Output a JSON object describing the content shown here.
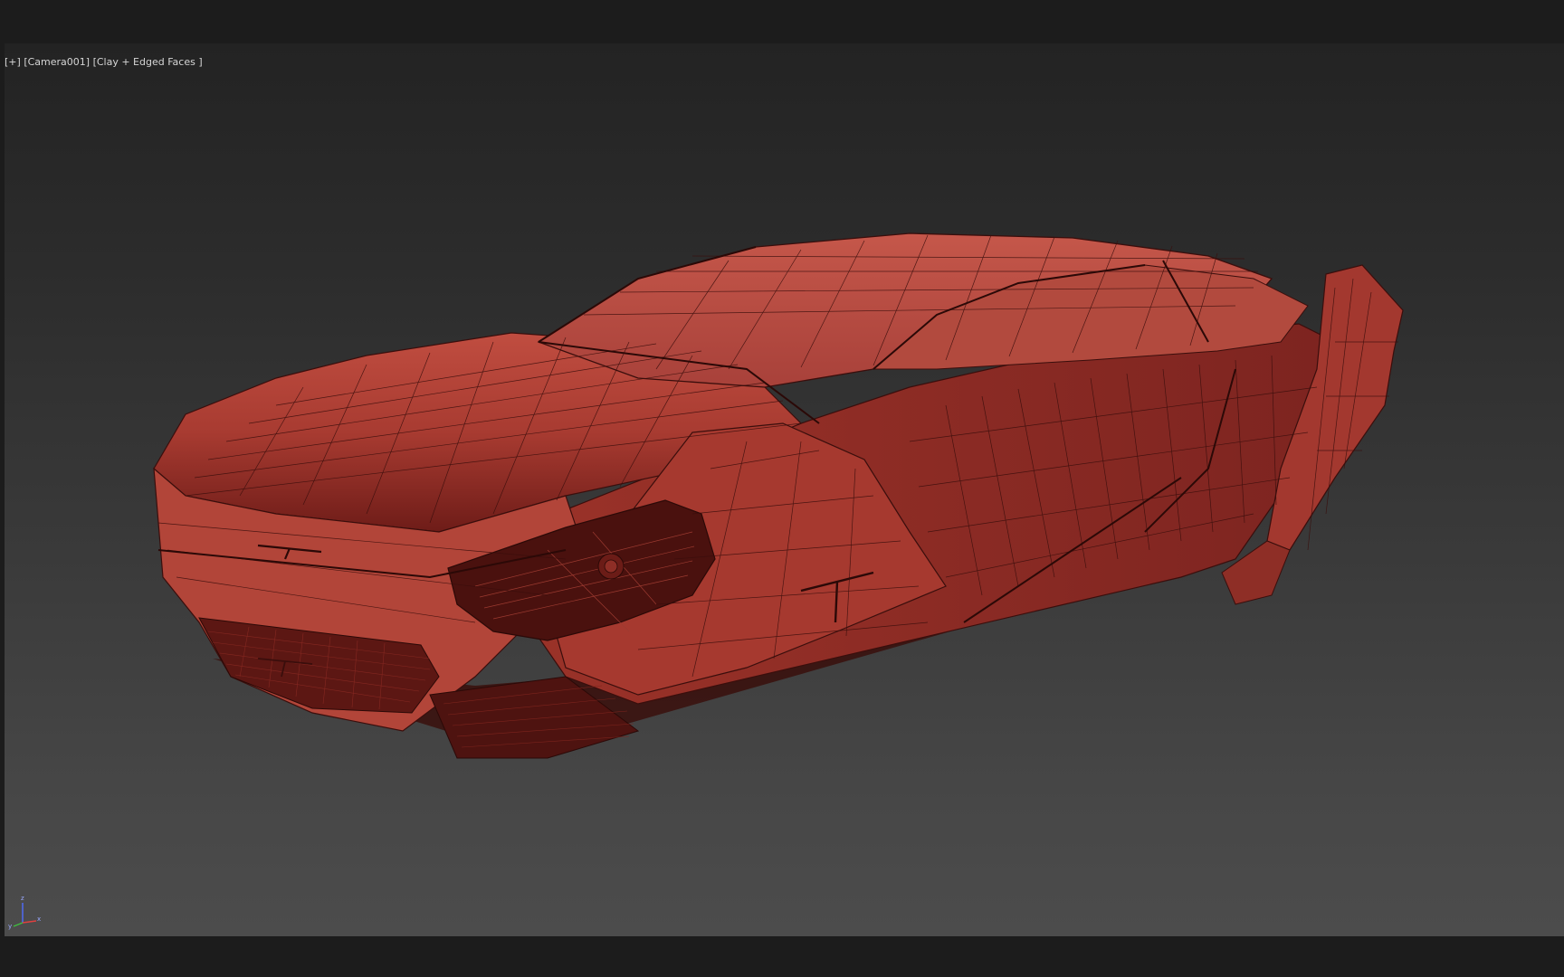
{
  "viewport": {
    "label_plus": "[+]",
    "label_camera": "[Camera001]",
    "label_shading": "[Clay + Edged Faces ]"
  },
  "gizmo": {
    "axis_z": "z",
    "axis_y": "y",
    "axis_x": "x"
  },
  "colors": {
    "clay": "#b4453a",
    "clay_dark": "#7a1f1b",
    "wire": "#3a0e0c",
    "viewport_top": "#232323",
    "viewport_bottom": "#4c4c4c"
  },
  "icons": {
    "scene_object": "car-clay-model",
    "axis_tripod": "world-axis-gizmo-icon"
  }
}
